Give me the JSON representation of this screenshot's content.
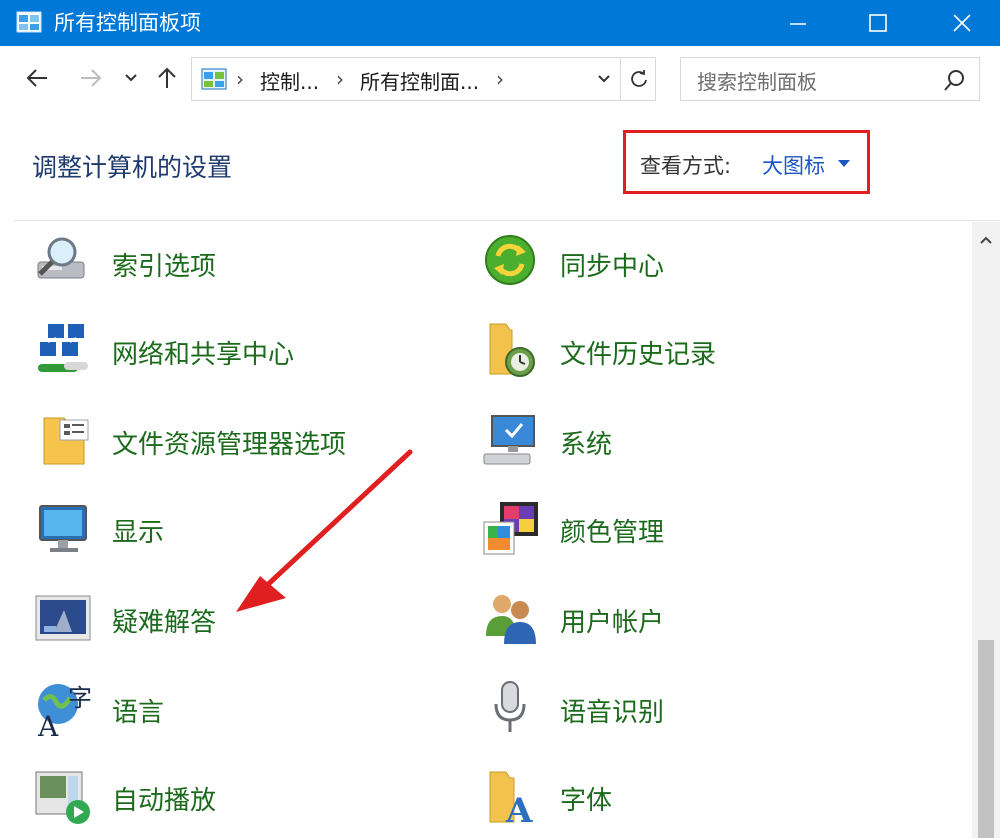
{
  "window": {
    "title": "所有控制面板项",
    "icon": "control-panel-icon"
  },
  "nav": {
    "back": "back-arrow-icon",
    "forward": "forward-arrow-icon",
    "recent": "chevron-down-icon",
    "up": "up-arrow-icon",
    "breadcrumb": [
      "控制...",
      "所有控制面...",
      ""
    ],
    "search_placeholder": "搜索控制面板"
  },
  "header": {
    "title": "调整计算机的设置",
    "view_by_label": "查看方式:",
    "view_by_value": "大图标"
  },
  "items": {
    "left": [
      {
        "label": "索引选项",
        "icon": "indexing-options-icon"
      },
      {
        "label": "网络和共享中心",
        "icon": "network-sharing-icon"
      },
      {
        "label": "文件资源管理器选项",
        "icon": "file-explorer-options-icon"
      },
      {
        "label": "显示",
        "icon": "display-icon"
      },
      {
        "label": "疑难解答",
        "icon": "troubleshooting-icon"
      },
      {
        "label": "语言",
        "icon": "language-icon"
      },
      {
        "label": "自动播放",
        "icon": "autoplay-icon"
      }
    ],
    "right": [
      {
        "label": "同步中心",
        "icon": "sync-center-icon"
      },
      {
        "label": "文件历史记录",
        "icon": "file-history-icon"
      },
      {
        "label": "系统",
        "icon": "system-icon"
      },
      {
        "label": "颜色管理",
        "icon": "color-management-icon"
      },
      {
        "label": "用户帐户",
        "icon": "user-accounts-icon"
      },
      {
        "label": "语音识别",
        "icon": "speech-recognition-icon"
      },
      {
        "label": "字体",
        "icon": "fonts-icon"
      }
    ]
  },
  "colors": {
    "titlebar": "#0078d7",
    "link_green": "#1c6b1c",
    "accent_blue": "#1a56c4",
    "highlight_red": "#e02020"
  }
}
